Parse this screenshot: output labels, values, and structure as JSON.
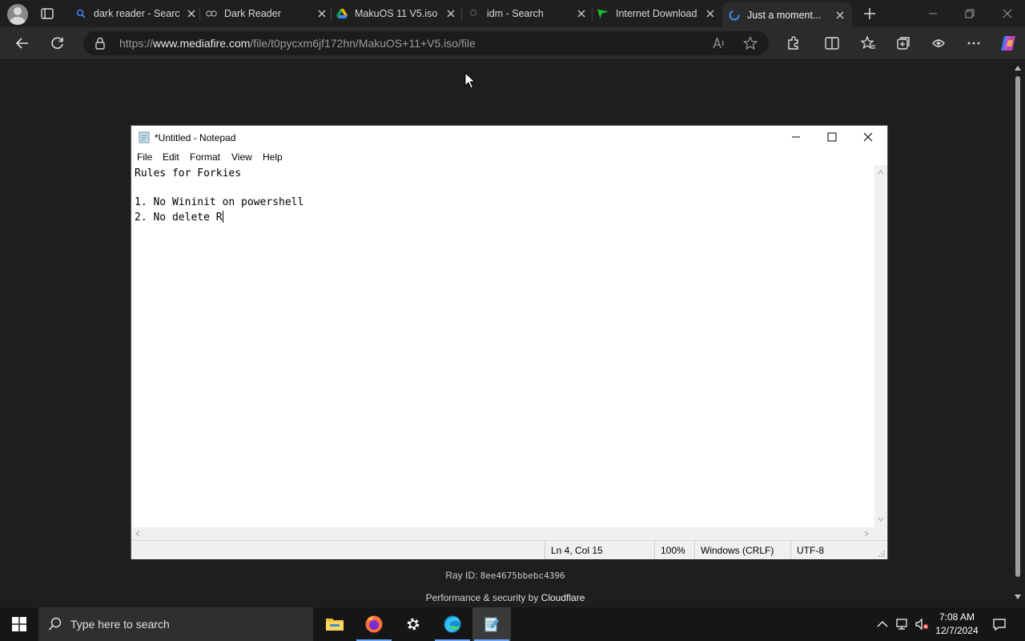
{
  "browser": {
    "tabs": [
      {
        "title": "dark reader - Searc",
        "favicon": "search-icon",
        "active": false
      },
      {
        "title": "Dark Reader",
        "favicon": "dark-reader-icon",
        "active": false
      },
      {
        "title": "MakuOS 11 V5.iso",
        "favicon": "drive-icon",
        "active": false
      },
      {
        "title": "idm - Search",
        "favicon": "search-icon",
        "active": false
      },
      {
        "title": "Internet Download",
        "favicon": "idm-icon",
        "active": false
      },
      {
        "title": "Just a moment...",
        "favicon": "loading-icon",
        "active": true
      }
    ],
    "address": {
      "protocol": "https://",
      "host": "www.mediafire.com",
      "path": "/file/t0pycxm6jf172hn/MakuOS+11+V5.iso/file"
    }
  },
  "page": {
    "ray_label": "Ray ID: ",
    "ray_id": "8ee4675bbebc4396",
    "perf_label": "Performance & security by ",
    "perf_brand": "Cloudflare"
  },
  "notepad": {
    "title": "*Untitled - Notepad",
    "menu": [
      "File",
      "Edit",
      "Format",
      "View",
      "Help"
    ],
    "lines": [
      "Rules for Forkies",
      "",
      "1. No Wininit on powershell",
      "2. No delete R"
    ],
    "status": {
      "position": "Ln 4, Col 15",
      "zoom": "100%",
      "line_ending": "Windows (CRLF)",
      "encoding": "UTF-8"
    }
  },
  "taskbar": {
    "search_placeholder": "Type here to search",
    "apps": [
      "file-explorer-icon",
      "firefox-icon",
      "settings-icon",
      "edge-icon",
      "notepad-icon"
    ],
    "time": "7:08 AM",
    "date": "12/7/2024"
  }
}
